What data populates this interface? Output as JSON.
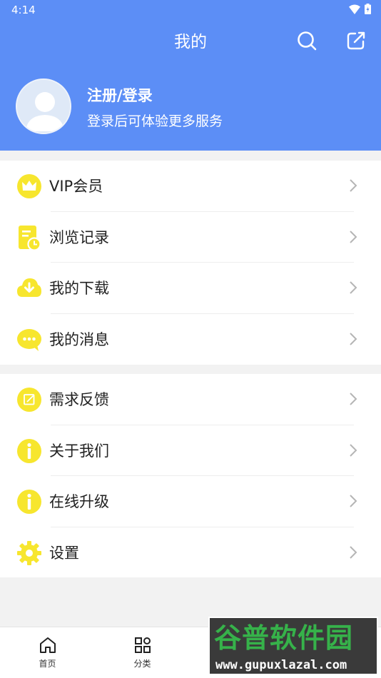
{
  "statusbar": {
    "time": "4:14"
  },
  "header": {
    "title": "我的"
  },
  "profile": {
    "login_title": "注册/登录",
    "login_sub": "登录后可体验更多服务"
  },
  "menu_group_1": [
    {
      "label": "VIP会员",
      "icon": "crown-icon"
    },
    {
      "label": "浏览记录",
      "icon": "history-icon"
    },
    {
      "label": "我的下载",
      "icon": "download-icon"
    },
    {
      "label": "我的消息",
      "icon": "message-icon"
    }
  ],
  "menu_group_2": [
    {
      "label": "需求反馈",
      "icon": "feedback-icon"
    },
    {
      "label": "关于我们",
      "icon": "info-icon"
    },
    {
      "label": "在线升级",
      "icon": "info-icon"
    },
    {
      "label": "设置",
      "icon": "gear-icon"
    }
  ],
  "tabs": [
    {
      "label": "首页",
      "icon": "home-icon"
    },
    {
      "label": "分类",
      "icon": "category-icon"
    },
    {
      "label": "",
      "icon": ""
    },
    {
      "label": "",
      "icon": ""
    }
  ],
  "watermark": {
    "logo": "谷普软件园",
    "url": "www.gupuxlazal.com"
  },
  "colors": {
    "header_bg": "#5c8ef6",
    "icon_yellow": "#f7e62e",
    "page_bg": "#f2f2f2"
  }
}
